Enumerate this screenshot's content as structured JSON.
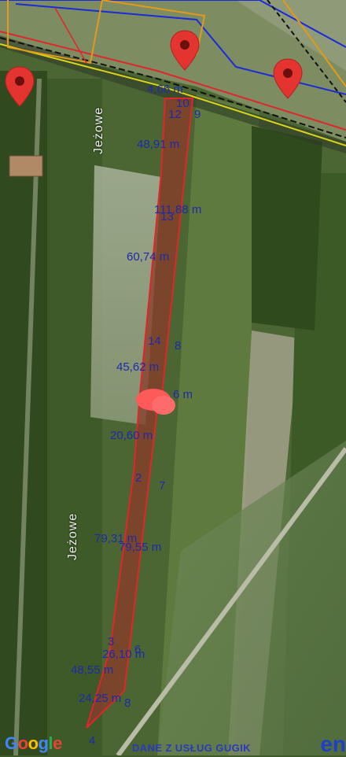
{
  "map": {
    "road_labels": [
      "Jeżowe",
      "Jeżowe"
    ],
    "measurements": [
      "4,66 m",
      "48,91 m",
      "111,88 m",
      "60,74 m",
      "45,62 m",
      "6 m",
      "20,60 m",
      "79,31 m",
      "79,55 m",
      "26,10 m",
      "48,55 m",
      "24,25 m"
    ],
    "point_numbers": [
      "10",
      "12",
      "9",
      "13",
      "14",
      "8",
      "2",
      "7",
      "3",
      "6",
      "8",
      "4"
    ],
    "markers": [
      "location-pin",
      "location-pin",
      "location-pin"
    ],
    "colors": {
      "parcel_fill": "#8a3b2a",
      "parcel_outline": "#e0262b",
      "label_text": "#1f2aa8",
      "pin": "#e3342f",
      "boundary_blue": "#1b2bd8",
      "boundary_orange": "#e39a1b",
      "boundary_yellow": "#d9d31a"
    }
  },
  "footer": {
    "google_logo": "Google",
    "attribution": "DANE Z USŁUG GUGIK",
    "brand_partial": "en"
  }
}
